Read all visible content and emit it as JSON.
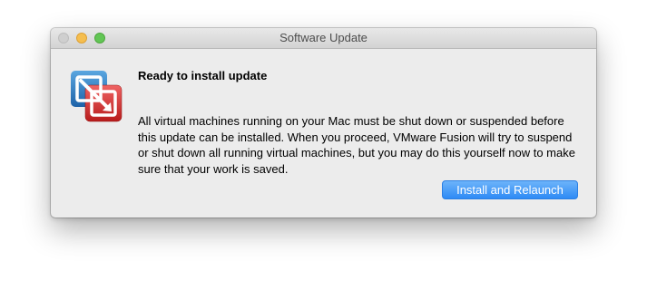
{
  "window": {
    "title": "Software Update"
  },
  "dialog": {
    "app_icon": "vmware-fusion-icon",
    "heading": "Ready to install update",
    "message": "All virtual machines running on your Mac must be shut down or suspended before this update can be installed. When you proceed, VMware Fusion will try to suspend or shut down all running virtual machines, but you may do this yourself now to make sure that your work is saved.",
    "primary_button": "Install and Relaunch"
  },
  "colors": {
    "accent": "#2e8bf5",
    "window_bg": "#ececec",
    "traffic_close": "#cfcfcf",
    "traffic_minimize": "#f5be4f",
    "traffic_zoom": "#62c655"
  }
}
